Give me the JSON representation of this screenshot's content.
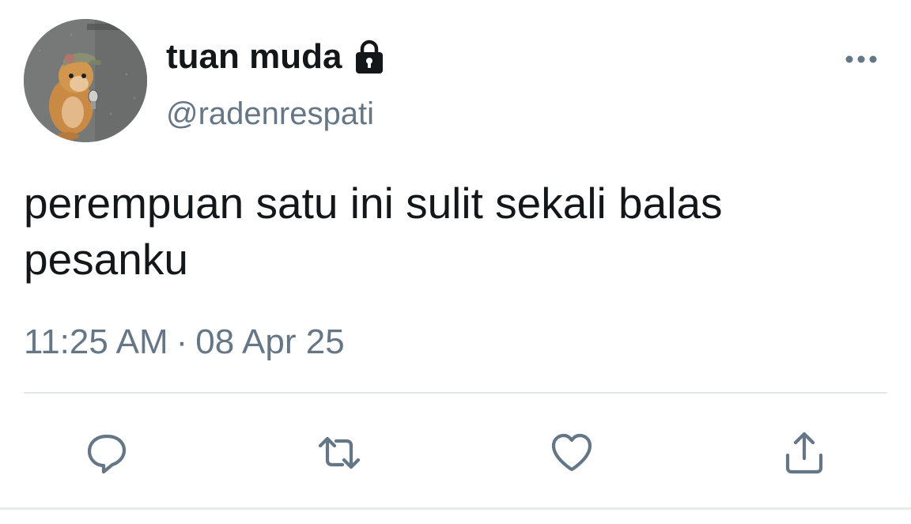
{
  "author": {
    "display_name": "tuan muda",
    "handle": "@radenrespati",
    "avatar_icon": "hamster-avatar",
    "protected_icon": "lock-icon"
  },
  "tweet": {
    "text": "perempuan satu ini sulit sekali balas pesanku",
    "time": "11:25 AM",
    "separator": "·",
    "date": "08 Apr 25"
  },
  "actions": {
    "reply_icon": "reply-icon",
    "retweet_icon": "retweet-icon",
    "like_icon": "heart-icon",
    "share_icon": "share-icon",
    "more_icon": "more-icon"
  },
  "colors": {
    "text_primary": "#14171a",
    "text_secondary": "#657786",
    "divider": "#e1e8ed"
  }
}
